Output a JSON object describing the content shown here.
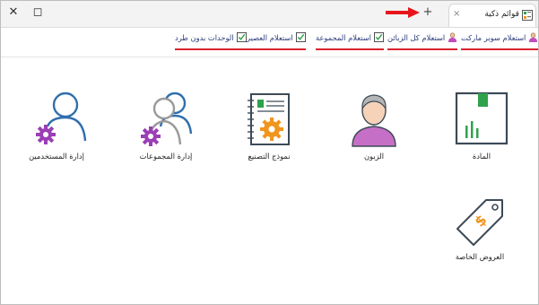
{
  "window": {
    "tab_title": "قوائم ذكية",
    "new_tab": "+",
    "close_glyph": "✕",
    "restore_glyph": "◻",
    "tab_close_glyph": "×"
  },
  "shortcuts": [
    {
      "label": "استعلام سوبر ماركت",
      "icon": "person-icon"
    },
    {
      "label": "استعلام كل الزبائن",
      "icon": "person-icon"
    },
    {
      "label": "استعلام المجموعة",
      "icon": "checklist-icon"
    },
    {
      "label": "استعلام العصير",
      "icon": "checklist-icon"
    },
    {
      "label": "الوحدات بدون طرد",
      "icon": "checklist-icon"
    }
  ],
  "tiles": [
    {
      "label": "المادة",
      "icon": "material-box-icon"
    },
    {
      "label": "الزبون",
      "icon": "customer-icon"
    },
    {
      "label": "نموذج التصنيع",
      "icon": "manufacturing-form-icon"
    },
    {
      "label": "إدارة المجموعات",
      "icon": "group-management-icon"
    },
    {
      "label": "إدارة المستخدمين",
      "icon": "user-management-icon"
    },
    {
      "label": "العروض الخاصة",
      "icon": "price-tag-icon"
    }
  ],
  "colors": {
    "underline": "#d9232e",
    "arrow": "#e8141c",
    "icon_dark": "#3c4a57",
    "icon_green": "#2fa24c",
    "gear_purple": "#9a3fb5",
    "user_blue": "#2f6fad",
    "orange": "#f0951e"
  }
}
